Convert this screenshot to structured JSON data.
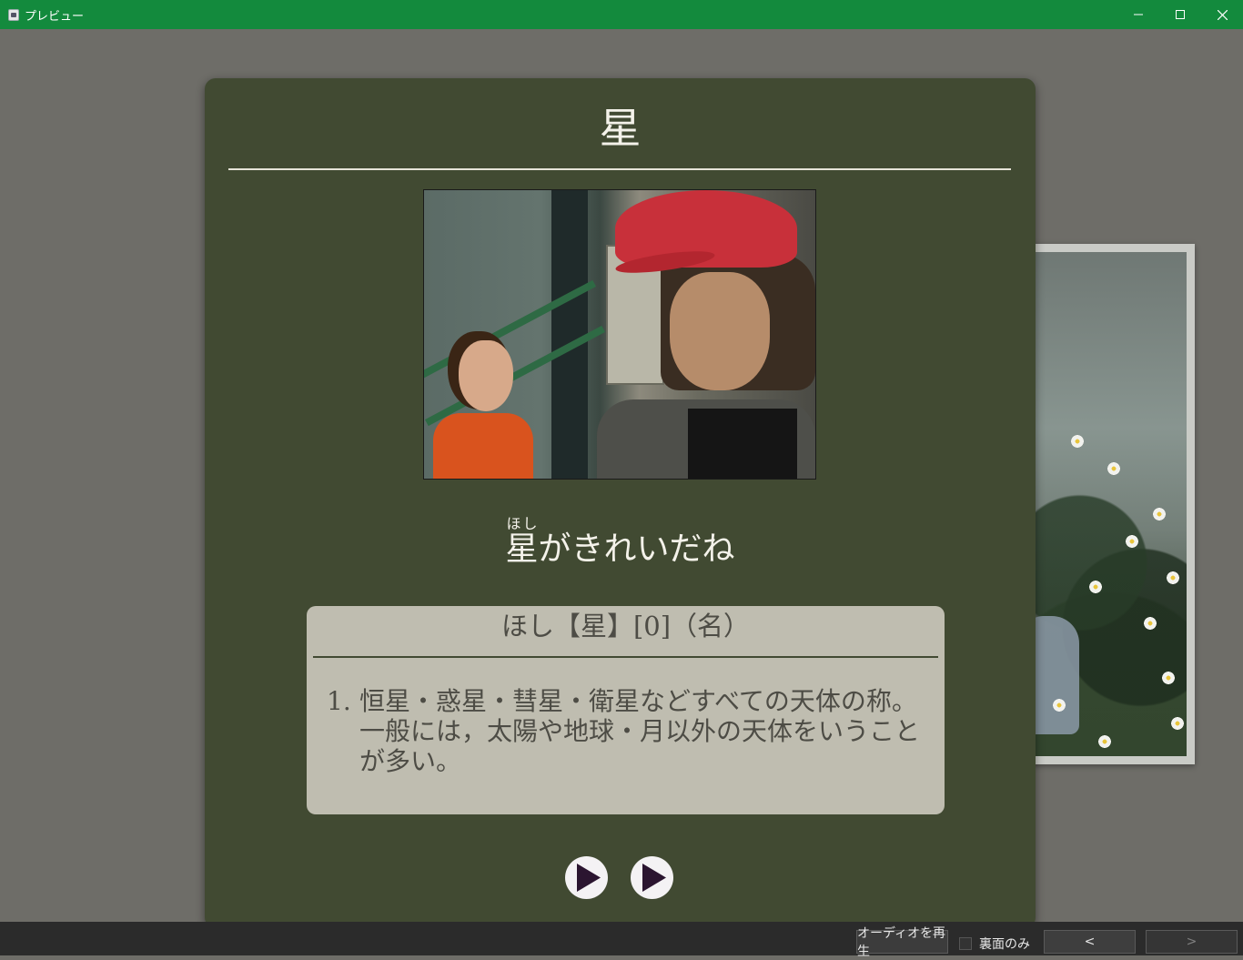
{
  "window": {
    "title": "プレビュー",
    "icon": "app-icon",
    "controls": {
      "minimize": "minimize-icon",
      "maximize": "maximize-icon",
      "close": "close-icon"
    },
    "accent_color": "#138a3d"
  },
  "card": {
    "title": "星",
    "background_color": "#414a32",
    "sentence": {
      "kanji": "星",
      "reading": "ほし",
      "rest": "がきれいだね"
    },
    "definition": {
      "header": "ほし【星】[0]（名）",
      "number": "1.",
      "text": "恒星・惑星・彗星・衛星などすべての天体の称。一般には，太陽や地球・月以外の天体をいうことが多い。"
    },
    "audio_buttons": [
      "play-icon",
      "play-icon"
    ]
  },
  "bottom_bar": {
    "play_audio_label": "オーディオを再生",
    "back_only_label": "裏面のみ",
    "back_only_checked": false,
    "prev_label": "<",
    "next_label": ">"
  }
}
